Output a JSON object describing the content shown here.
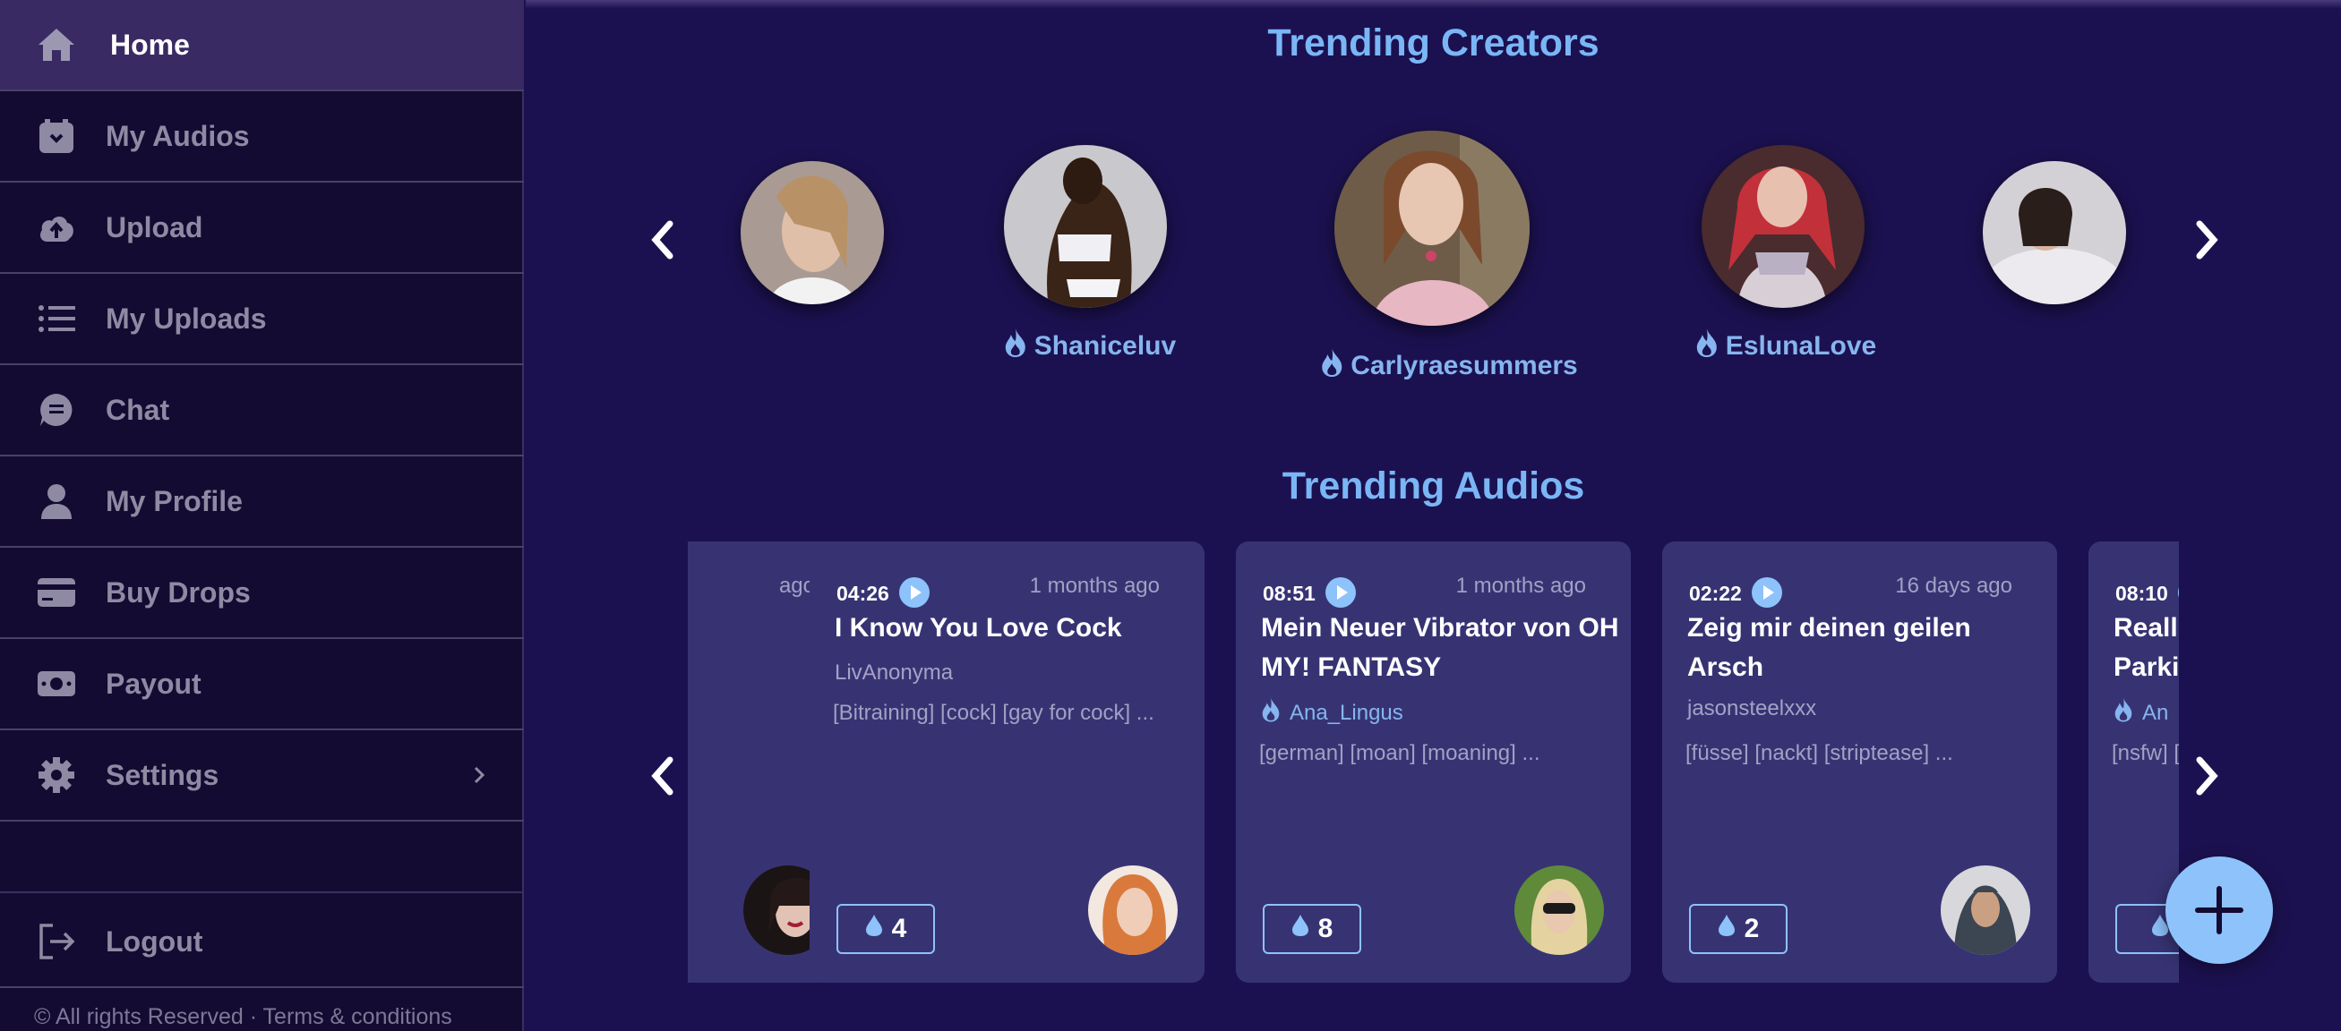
{
  "sidebar": {
    "items": [
      {
        "label": "Home",
        "icon": "home-icon",
        "active": true
      },
      {
        "label": "My Audios",
        "icon": "audio-box-icon"
      },
      {
        "label": "Upload",
        "icon": "cloud-upload-icon"
      },
      {
        "label": "My Uploads",
        "icon": "list-icon"
      },
      {
        "label": "Chat",
        "icon": "chat-icon"
      },
      {
        "label": "My Profile",
        "icon": "person-icon"
      },
      {
        "label": "Buy Drops",
        "icon": "credit-card-icon"
      },
      {
        "label": "Payout",
        "icon": "money-icon"
      },
      {
        "label": "Settings",
        "icon": "gear-icon"
      }
    ],
    "logout_label": "Logout",
    "copyright": "© All rights Reserved · Terms & conditions"
  },
  "trending_creators": {
    "title": "Trending Creators",
    "creators": [
      {
        "name": ""
      },
      {
        "name": "Shaniceluv"
      },
      {
        "name": "Carlyraesummers"
      },
      {
        "name": "EslunaLove"
      },
      {
        "name": ""
      }
    ]
  },
  "trending_audios": {
    "title": "Trending Audios",
    "cards": [
      {
        "duration": "",
        "ago": "ago",
        "title": "",
        "author": "",
        "verified": false,
        "tags": "",
        "drops": ""
      },
      {
        "duration": "04:26",
        "ago": "1 months ago",
        "title": "I Know You Love Cock",
        "author": "LivAnonyma",
        "verified": false,
        "tags": "[Bitraining] [cock] [gay for cock] ...",
        "drops": "4"
      },
      {
        "duration": "08:51",
        "ago": "1 months ago",
        "title": "Mein Neuer Vibrator von OH MY! FANTASY",
        "author": "Ana_Lingus",
        "verified": true,
        "tags": "[german] [moan] [moaning] ...",
        "drops": "8"
      },
      {
        "duration": "02:22",
        "ago": "16 days ago",
        "title": "Zeig mir deinen geilen Arsch",
        "author": "jasonsteelxxx",
        "verified": false,
        "tags": "[füsse] [nackt] [striptease] ...",
        "drops": "2"
      },
      {
        "duration": "08:10",
        "ago": "",
        "title": "Realli Parkin",
        "author": "An",
        "verified": true,
        "tags": "[nsfw] [",
        "drops": ""
      }
    ]
  },
  "colors": {
    "background": "#1c1150",
    "sidebar": "#140b32",
    "accent": "#7ab6f5",
    "card": "#373373",
    "fab": "#8ec2fb"
  }
}
